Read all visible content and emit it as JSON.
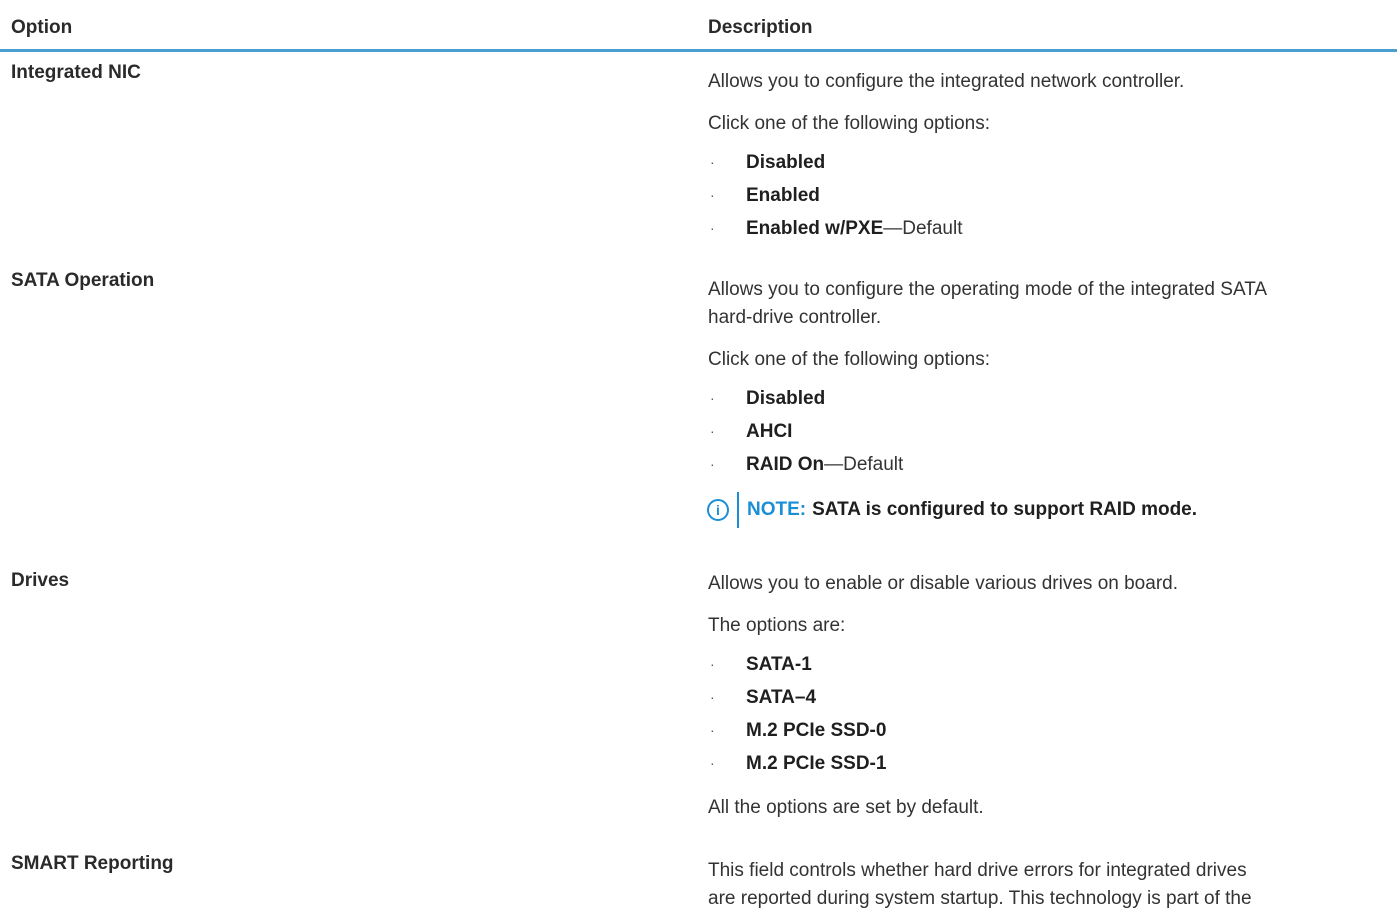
{
  "header": {
    "option": "Option",
    "description": "Description"
  },
  "rows": [
    {
      "option": "Integrated NIC",
      "intro": "Allows you to configure the integrated network controller.",
      "list_intro": "Click one of the following options:",
      "items": [
        {
          "label": "Disabled",
          "suffix": ""
        },
        {
          "label": "Enabled",
          "suffix": ""
        },
        {
          "label": "Enabled w/PXE",
          "suffix": "—Default"
        }
      ]
    },
    {
      "option": "SATA Operation",
      "intro_line1": "Allows you to configure the operating mode of the integrated SATA",
      "intro_line2": "hard-drive controller.",
      "list_intro": "Click one of the following options:",
      "items": [
        {
          "label": "Disabled",
          "suffix": ""
        },
        {
          "label": "AHCI",
          "suffix": ""
        },
        {
          "label": "RAID On",
          "suffix": "—Default"
        }
      ],
      "note": {
        "icon": "info-icon",
        "label": "NOTE:",
        "text": "SATA is configured to support RAID mode."
      }
    },
    {
      "option": "Drives",
      "intro": "Allows you to enable or disable various drives on board.",
      "list_intro": "The options are:",
      "items": [
        {
          "label": "SATA-1",
          "suffix": ""
        },
        {
          "label": "SATA–4",
          "suffix": ""
        },
        {
          "label": "M.2 PCIe SSD-0",
          "suffix": ""
        },
        {
          "label": "M.2 PCIe SSD-1",
          "suffix": ""
        }
      ],
      "outro": "All the options are set by default."
    },
    {
      "option": "SMART Reporting",
      "intro_line1": "This field controls whether hard drive errors for integrated drives",
      "intro_line2": "are reported during system startup. This technology is part of the"
    }
  ],
  "colors": {
    "accent": "#1a8fd6",
    "header_rule": "#4a9fd0",
    "text": "#2b2b2b"
  },
  "bullet_glyph": "·"
}
